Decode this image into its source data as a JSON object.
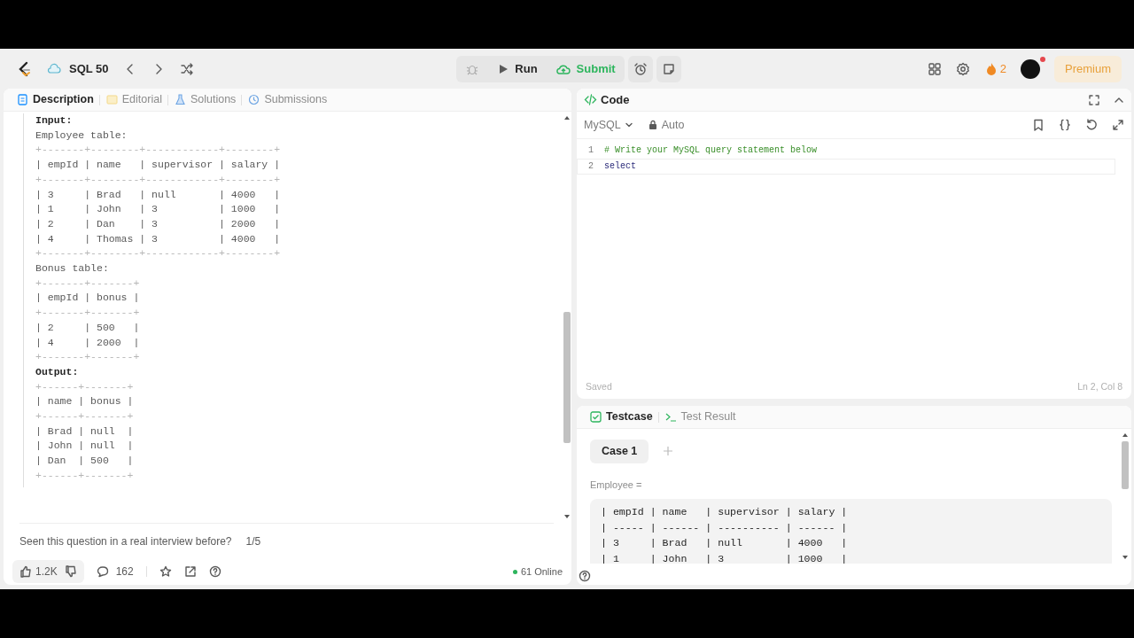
{
  "header": {
    "list_title": "SQL 50",
    "run_label": "Run",
    "submit_label": "Submit",
    "streak": "2",
    "premium_label": "Premium"
  },
  "left_tabs": [
    {
      "label": "Description",
      "selected": true
    },
    {
      "label": "Editorial",
      "selected": false
    },
    {
      "label": "Solutions",
      "selected": false
    },
    {
      "label": "Submissions",
      "selected": false
    }
  ],
  "description": [
    {
      "kind": "heading",
      "text": "Input:"
    },
    {
      "kind": "label",
      "text": "Employee table:"
    },
    {
      "kind": "table",
      "lines": [
        "+-------+--------+------------+--------+",
        "| empId | name   | supervisor | salary |",
        "+-------+--------+------------+--------+",
        "| 3     | Brad   | null       | 4000   |",
        "| 1     | John   | 3          | 1000   |",
        "| 2     | Dan    | 3          | 2000   |",
        "| 4     | Thomas | 3          | 4000   |",
        "+-------+--------+------------+--------+"
      ]
    },
    {
      "kind": "label",
      "text": "Bonus table:"
    },
    {
      "kind": "table",
      "lines": [
        "+-------+-------+",
        "| empId | bonus |",
        "+-------+-------+",
        "| 2     | 500   |",
        "| 4     | 2000  |",
        "+-------+-------+"
      ]
    },
    {
      "kind": "heading",
      "text": "Output:"
    },
    {
      "kind": "table",
      "lines": [
        "+------+-------+",
        "| name | bonus |",
        "+------+-------+",
        "| Brad | null  |",
        "| John | null  |",
        "| Dan  | 500   |",
        "+------+-------+"
      ]
    }
  ],
  "interview": {
    "question": "Seen this question in a real interview before?",
    "rating": "1/5"
  },
  "footer": {
    "likes": "1.2K",
    "comments": "162",
    "online": "61 Online"
  },
  "code": {
    "title": "Code",
    "language": "MySQL",
    "mode": "Auto",
    "status": "Saved",
    "cursor": "Ln 2, Col 8",
    "lines": [
      {
        "number": "1",
        "kind": "comment",
        "text": "# Write your MySQL query statement below",
        "current": false
      },
      {
        "number": "2",
        "kind": "keyword",
        "text": "select",
        "current": true
      }
    ]
  },
  "test_tabs": [
    {
      "label": "Testcase",
      "selected": true
    },
    {
      "label": "Test Result",
      "selected": false
    }
  ],
  "cases": [
    {
      "label": "Case 1",
      "selected": true
    }
  ],
  "parameter": {
    "label": "Employee =",
    "lines": [
      "| empId | name   | supervisor | salary |",
      "| ----- | ------ | ---------- | ------ |",
      "| 3     | Brad   | null       | 4000   |",
      "| 1     | John   | 3          | 1000   |"
    ]
  }
}
